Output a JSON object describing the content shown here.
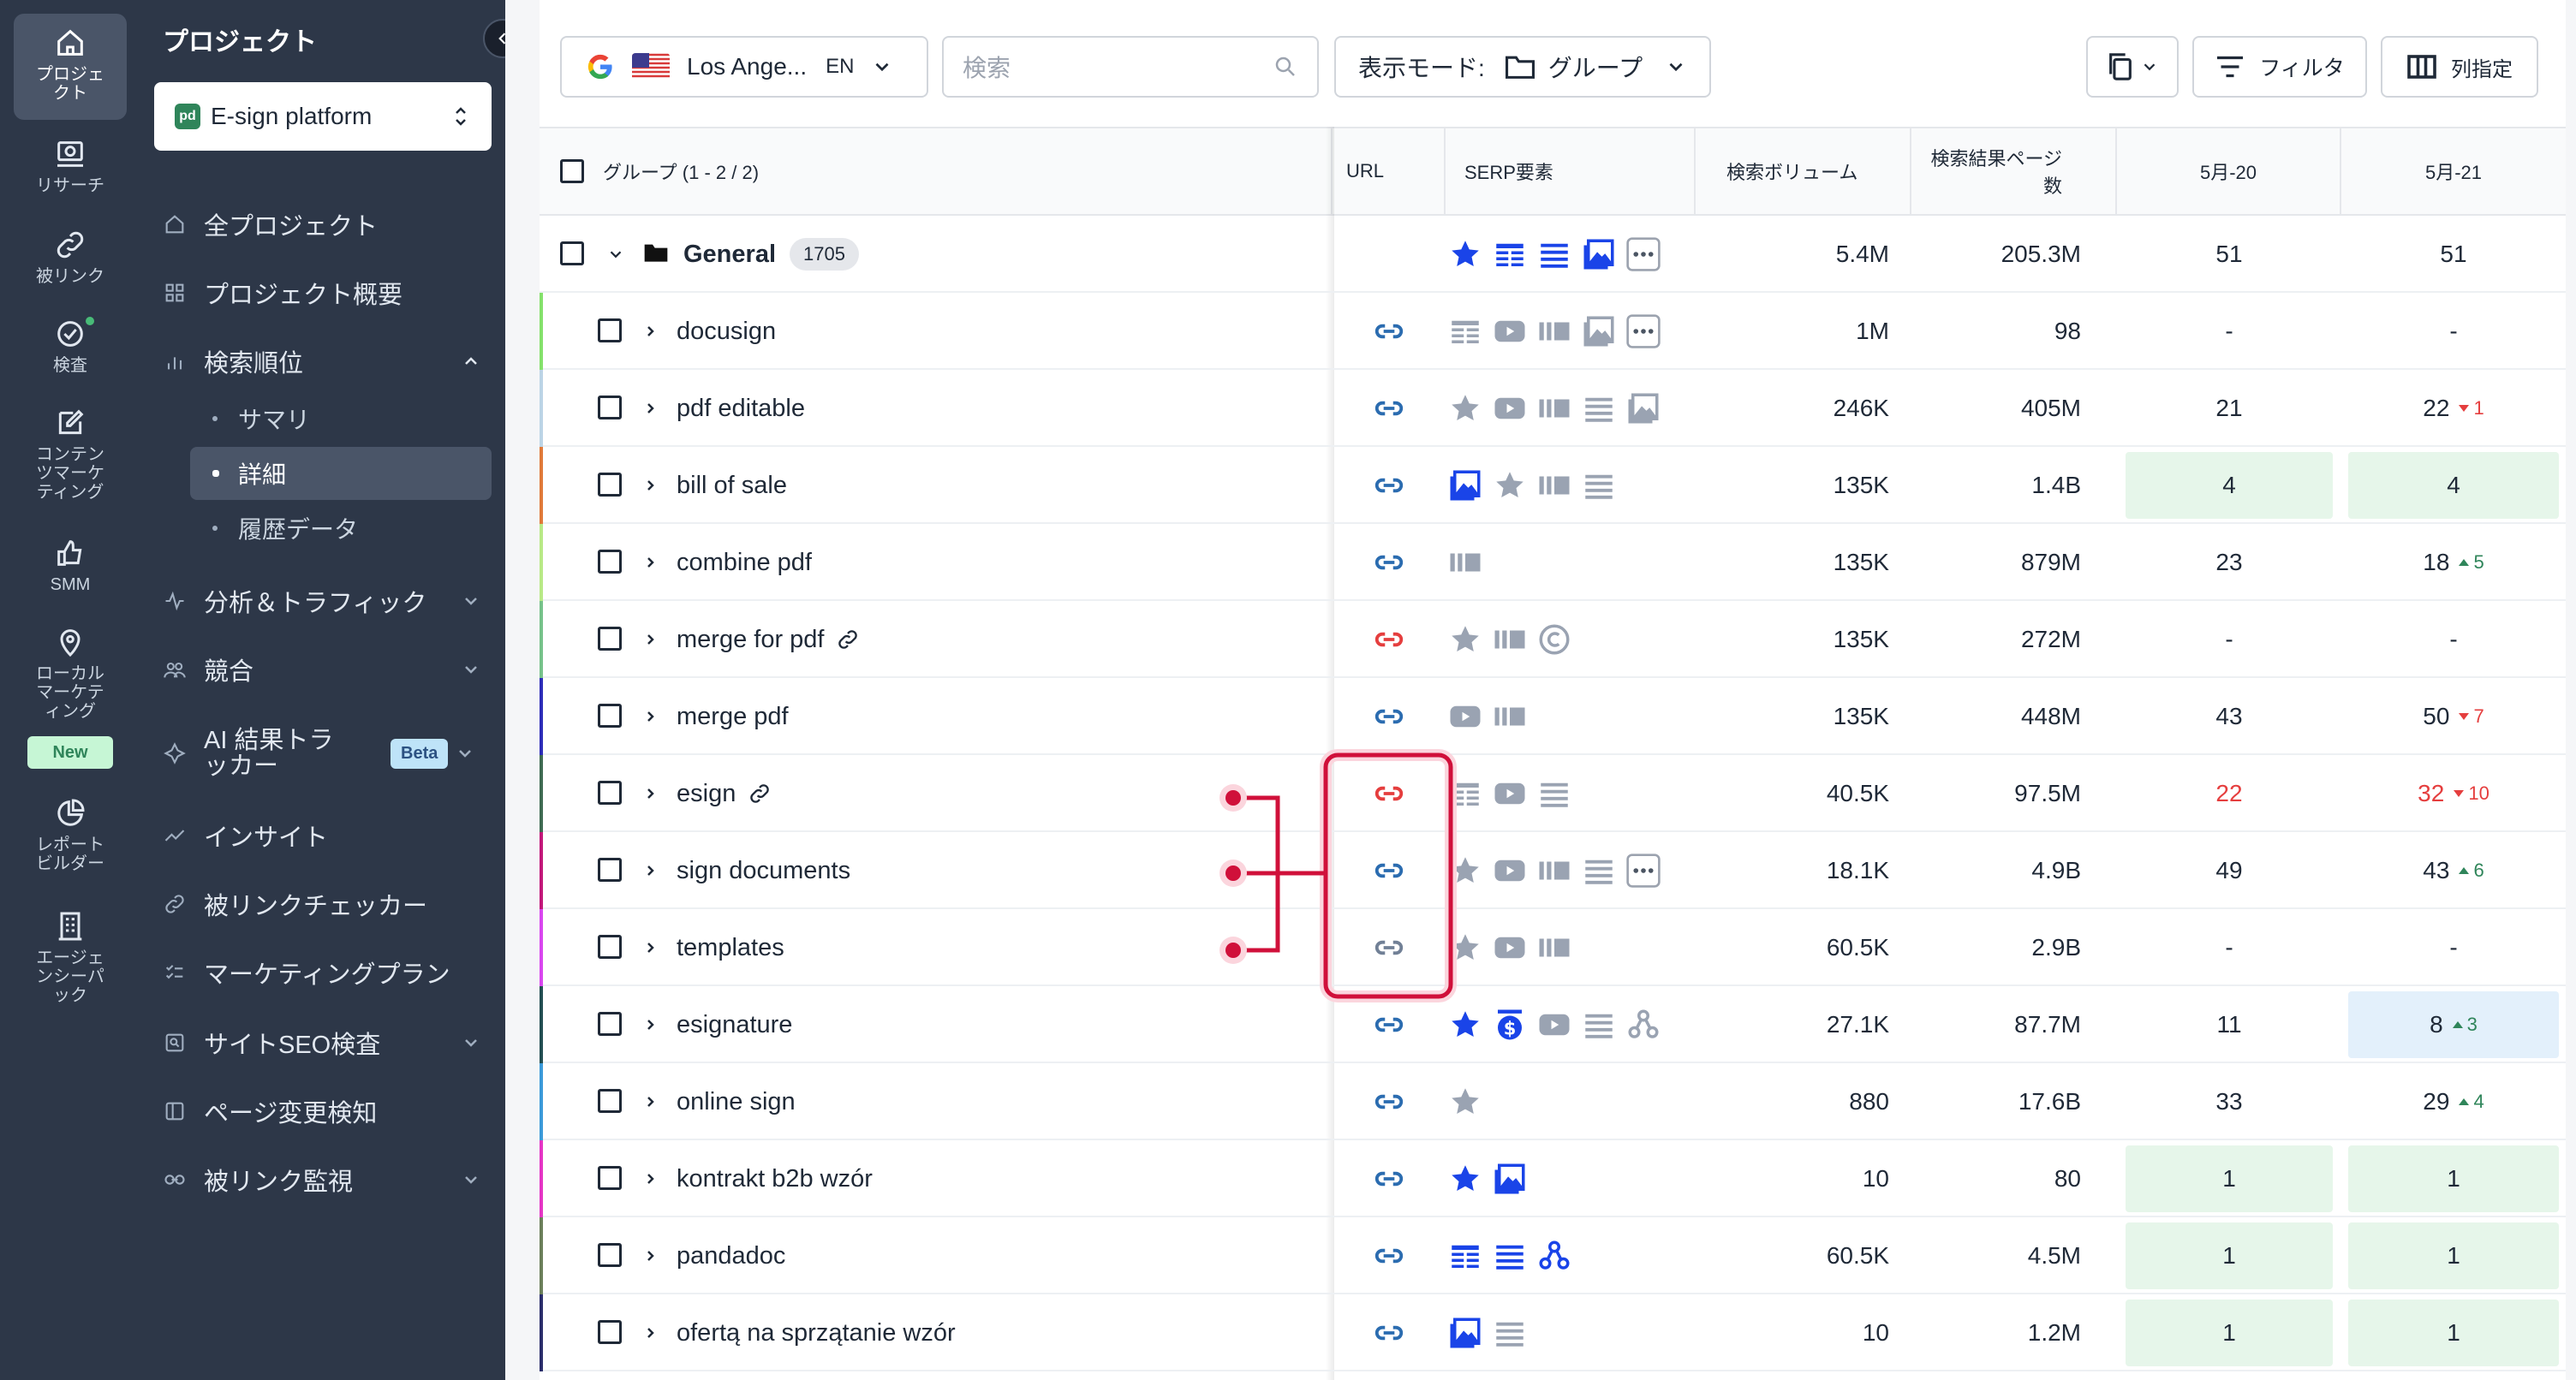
{
  "rail": {
    "items": [
      {
        "label": "プロジェクト",
        "icon": "home-icon"
      },
      {
        "label": "リサーチ",
        "icon": "research-icon"
      },
      {
        "label": "被リンク",
        "icon": "link-icon"
      },
      {
        "label": "検査",
        "icon": "check-circle-icon"
      },
      {
        "label": "コンテンツマーケティング",
        "icon": "edit-icon"
      },
      {
        "label": "SMM",
        "icon": "thumbs-up-icon"
      },
      {
        "label": "ローカルマーケティング",
        "icon": "map-pin-icon"
      },
      {
        "label": "レポートビルダー",
        "icon": "pie-chart-icon"
      },
      {
        "label": "エージェンシーパック",
        "icon": "building-icon"
      }
    ],
    "new_badge": "New"
  },
  "sidebar": {
    "title": "プロジェクト",
    "project": "E-sign platform",
    "project_logo": "pd",
    "items": [
      {
        "label": "全プロジェクト"
      },
      {
        "label": "プロジェクト概要"
      },
      {
        "label": "検索順位"
      },
      {
        "label": "分析＆トラフィック"
      },
      {
        "label": "競合"
      },
      {
        "label": "AI 結果トラッカー"
      },
      {
        "label": "インサイト"
      },
      {
        "label": "被リンクチェッカー"
      },
      {
        "label": "マーケティングプラン"
      },
      {
        "label": "サイトSEO検査"
      },
      {
        "label": "ページ変更検知"
      },
      {
        "label": "被リンク監視"
      }
    ],
    "sub_items": [
      {
        "label": "サマリ"
      },
      {
        "label": "詳細"
      },
      {
        "label": "履歴データ"
      }
    ],
    "beta": "Beta"
  },
  "toolbar": {
    "location": "Los Ange...",
    "lang": "EN",
    "search_placeholder": "検索",
    "view_mode_label": "表示モード:",
    "view_mode_value": "グループ",
    "filter_label": "フィルタ",
    "columns_label": "列指定"
  },
  "table": {
    "headers": {
      "group": "グループ (1 - 2 / 2)",
      "url": "URL",
      "serp": "SERP要素",
      "volume": "検索ボリューム",
      "results_1": "検索結果ページ",
      "results_2": "数",
      "date1": "5月-20",
      "date2": "5月-21"
    },
    "group_row": {
      "name": "General",
      "count": "1705",
      "volume": "5.4M",
      "results": "205.3M",
      "d1": "51",
      "d2": "51"
    },
    "rows": [
      {
        "kw": "docusign",
        "volume": "1M",
        "results": "98",
        "d1": "-",
        "d2": "-",
        "delta": "",
        "stripe": "#84e16b"
      },
      {
        "kw": "pdf editable",
        "volume": "246K",
        "results": "405M",
        "d1": "21",
        "d2": "22",
        "delta": "1",
        "stripe": "#bcd4e6"
      },
      {
        "kw": "bill of sale",
        "volume": "135K",
        "results": "1.4B",
        "d1": "4",
        "d2": "4",
        "delta": "",
        "stripe": "#e07a3a"
      },
      {
        "kw": "combine pdf",
        "volume": "135K",
        "results": "879M",
        "d1": "23",
        "d2": "18",
        "delta": "5",
        "stripe": "#b8e986"
      },
      {
        "kw": "merge for pdf",
        "volume": "135K",
        "results": "272M",
        "d1": "-",
        "d2": "-",
        "delta": "",
        "stripe": "#76c28a"
      },
      {
        "kw": "merge pdf",
        "volume": "135K",
        "results": "448M",
        "d1": "43",
        "d2": "50",
        "delta": "7",
        "stripe": "#2d2db8"
      },
      {
        "kw": "esign",
        "volume": "40.5K",
        "results": "97.5M",
        "d1": "22",
        "d2": "32",
        "delta": "10",
        "stripe": "#3f6b52"
      },
      {
        "kw": "sign documents",
        "volume": "18.1K",
        "results": "4.9B",
        "d1": "49",
        "d2": "43",
        "delta": "6",
        "stripe": "#c2187a"
      },
      {
        "kw": "templates",
        "volume": "60.5K",
        "results": "2.9B",
        "d1": "-",
        "d2": "-",
        "delta": "",
        "stripe": "#d946ef"
      },
      {
        "kw": "esignature",
        "volume": "27.1K",
        "results": "87.7M",
        "d1": "11",
        "d2": "8",
        "delta": "3",
        "stripe": "#234e52"
      },
      {
        "kw": "online sign",
        "volume": "880",
        "results": "17.6B",
        "d1": "33",
        "d2": "29",
        "delta": "4",
        "stripe": "#3b9ad9"
      },
      {
        "kw": "kontrakt b2b wzór",
        "volume": "10",
        "results": "80",
        "d1": "1",
        "d2": "1",
        "delta": "",
        "stripe": "#e535c5"
      },
      {
        "kw": "pandadoc",
        "volume": "60.5K",
        "results": "4.5M",
        "d1": "1",
        "d2": "1",
        "delta": "",
        "stripe": "#6b7f5a"
      },
      {
        "kw": "ofertą na sprzątanie wzór",
        "volume": "10",
        "results": "1.2M",
        "d1": "1",
        "d2": "1",
        "delta": "",
        "stripe": "#2b2e6b"
      }
    ]
  },
  "colors": {
    "accent": "#1a44e8",
    "link_blue": "#2b6cb0",
    "link_red": "#e53e3e",
    "link_gray": "#718096",
    "highlight": "#d0103a",
    "pos_green": "#e6f6ea",
    "pos_blue": "#e3f0fb"
  }
}
